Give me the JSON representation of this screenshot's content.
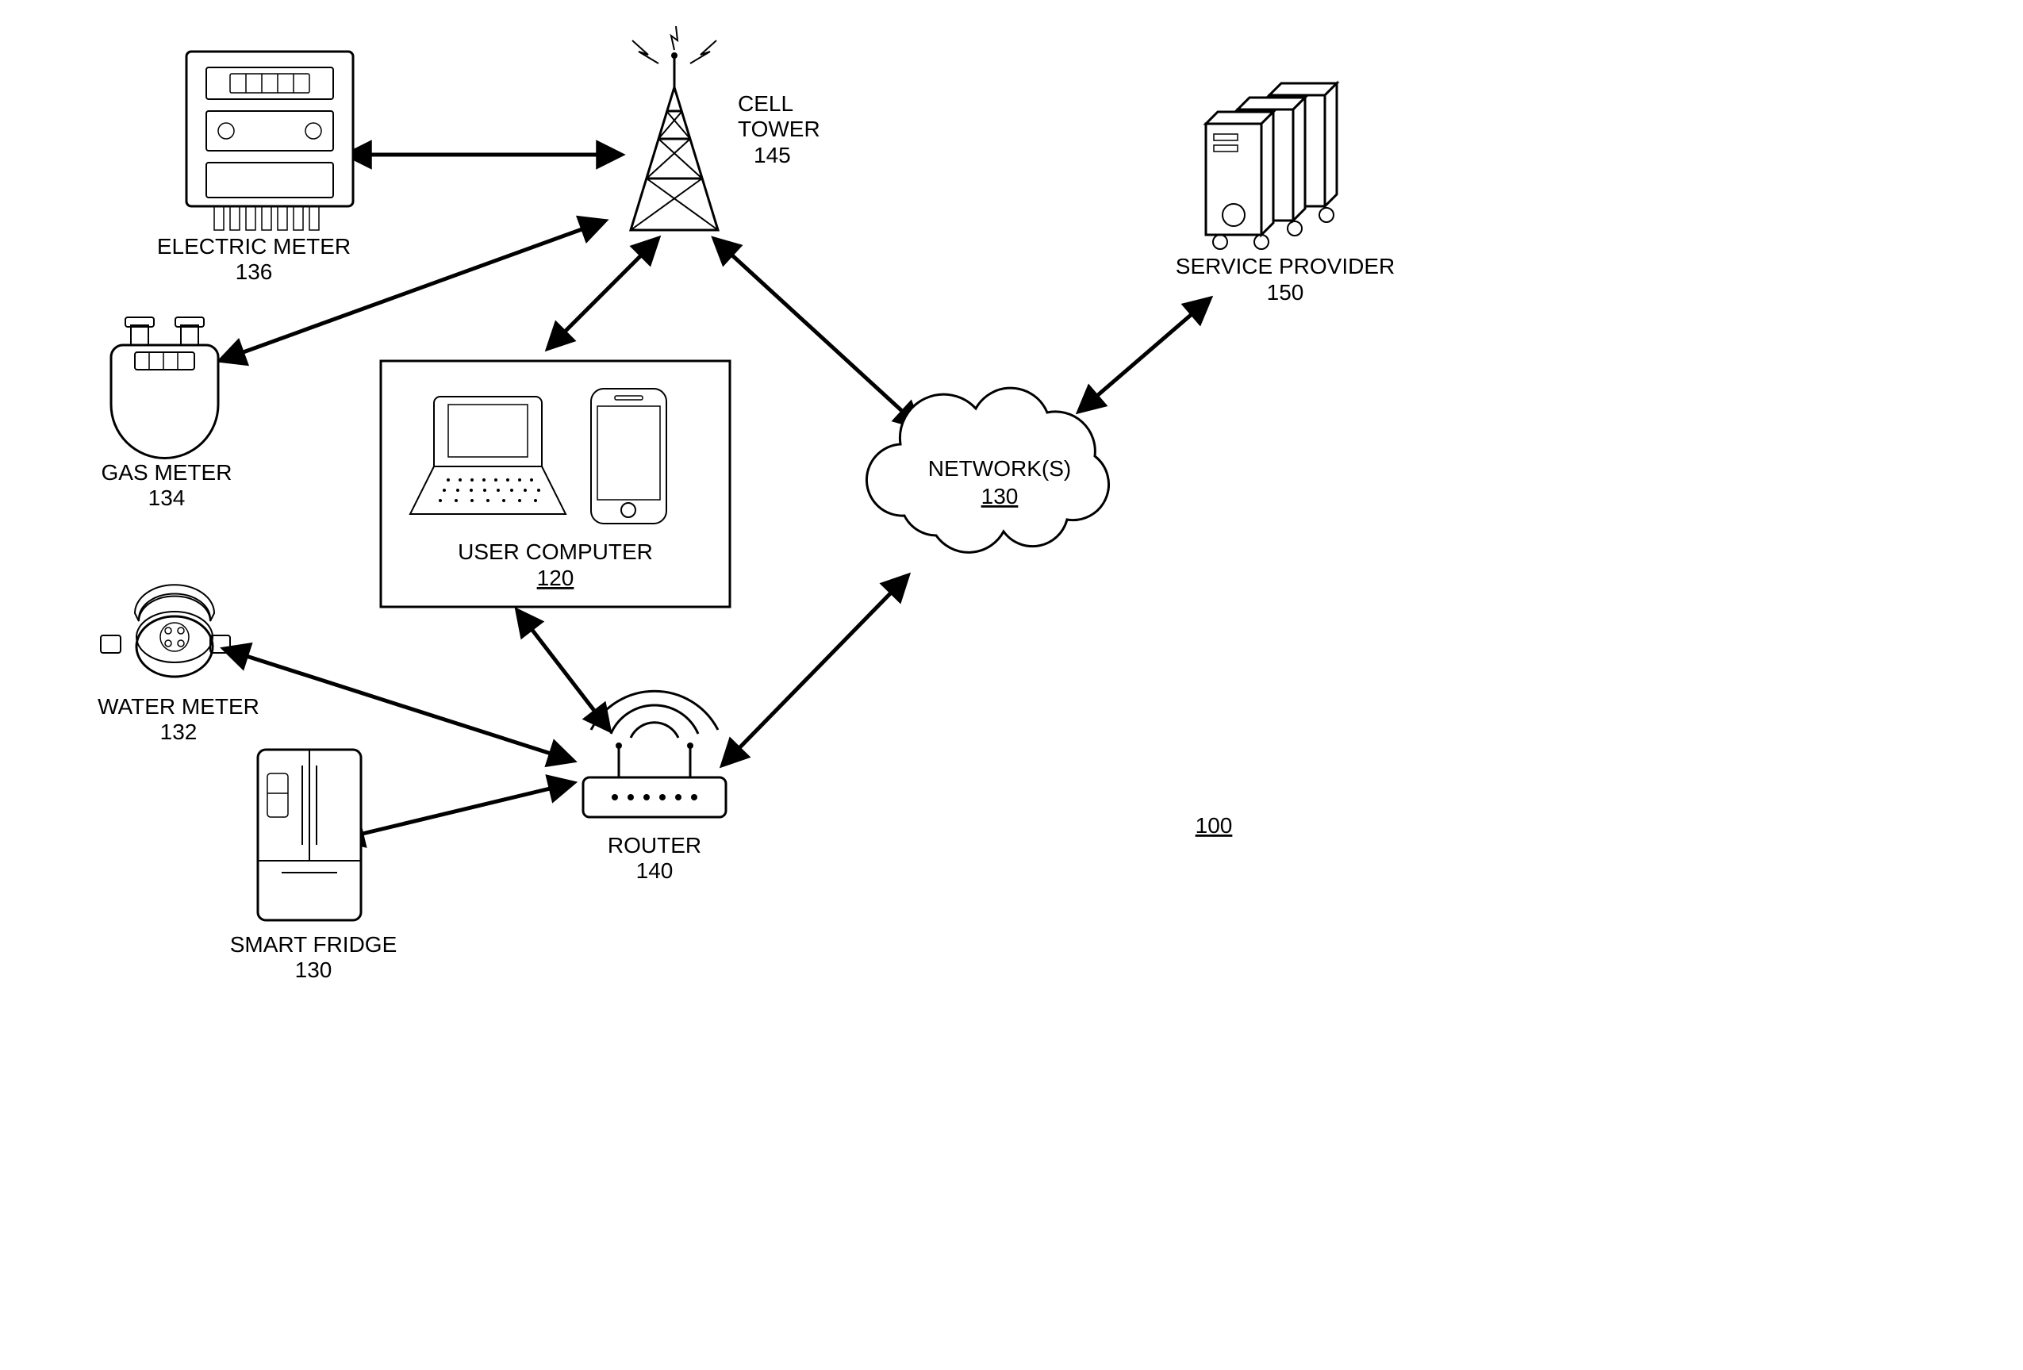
{
  "figure_ref": "100",
  "nodes": {
    "electric_meter": {
      "label": "ELECTRIC METER",
      "ref": "136"
    },
    "gas_meter": {
      "label": "GAS METER",
      "ref": "134"
    },
    "water_meter": {
      "label": "WATER METER",
      "ref": "132"
    },
    "smart_fridge": {
      "label": "SMART FRIDGE",
      "ref": "130"
    },
    "user_computer": {
      "label": "USER COMPUTER",
      "ref": "120"
    },
    "router": {
      "label": "ROUTER",
      "ref": "140"
    },
    "cell_tower": {
      "label": "CELL TOWER",
      "ref": "145"
    },
    "networks": {
      "label": "NETWORK(S)",
      "ref": "130"
    },
    "service_provider": {
      "label": "SERVICE PROVIDER",
      "ref": "150"
    }
  },
  "connections": [
    [
      "electric_meter",
      "cell_tower"
    ],
    [
      "gas_meter",
      "cell_tower"
    ],
    [
      "cell_tower",
      "user_computer"
    ],
    [
      "cell_tower",
      "networks"
    ],
    [
      "user_computer",
      "router"
    ],
    [
      "water_meter",
      "router"
    ],
    [
      "smart_fridge",
      "router"
    ],
    [
      "router",
      "networks"
    ],
    [
      "networks",
      "service_provider"
    ]
  ]
}
